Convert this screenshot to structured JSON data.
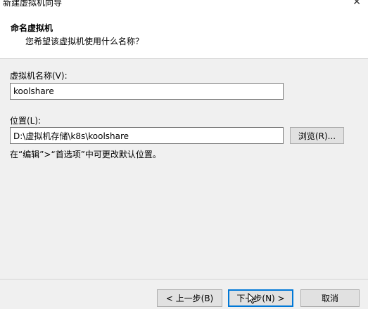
{
  "window": {
    "title": "新建虚拟机向导",
    "close_glyph": "✕"
  },
  "header": {
    "title": "命名虚拟机",
    "subtitle": "您希望该虚拟机使用什么名称？"
  },
  "form": {
    "name_label": "虚拟机名称(V):",
    "name_value": "koolshare",
    "location_label": "位置(L):",
    "location_value": "D:\\虚拟机存储\\k8s\\koolshare",
    "browse_label": "浏览(R)...",
    "hint": "在“编辑”>“首选项”中可更改默认位置。"
  },
  "footer": {
    "back_label": "< 上一步(B)",
    "next_label": "下一步(N) >",
    "cancel_label": "取消"
  },
  "colors": {
    "accent": "#0078d7",
    "button_bg": "#e1e1e1",
    "window_bg": "#f0f0f0"
  }
}
